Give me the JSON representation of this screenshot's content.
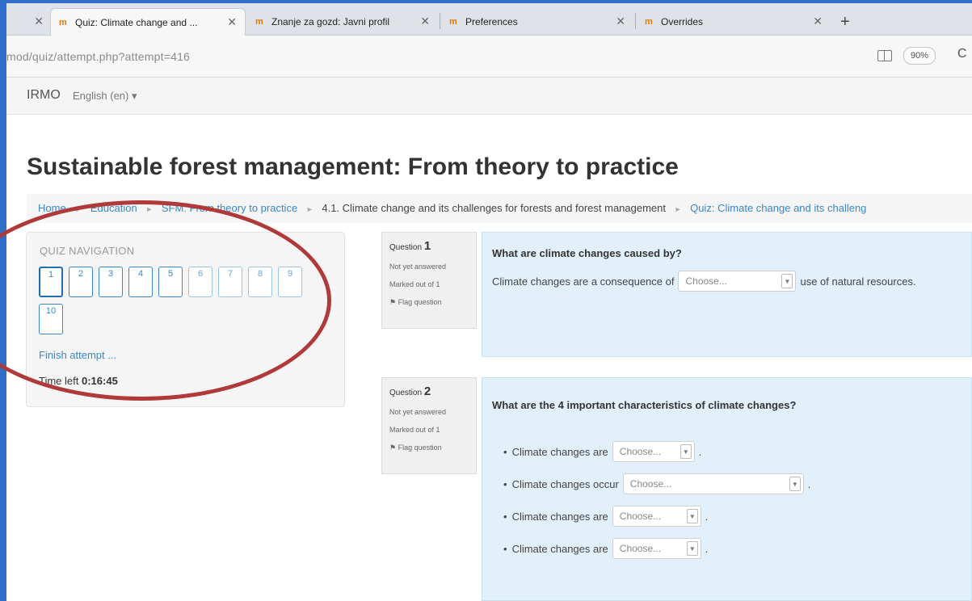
{
  "browser": {
    "tabs": [
      {
        "label": "",
        "active": false
      },
      {
        "label": "Quiz: Climate change and ...",
        "active": true
      },
      {
        "label": "Znanje za gozd: Javni profil",
        "active": false
      },
      {
        "label": "Preferences",
        "active": false
      },
      {
        "label": "Overrides",
        "active": false
      }
    ],
    "favicon_glyph": "m",
    "close_glyph": "✕",
    "new_tab_glyph": "+",
    "url": "mod/quiz/attempt.php?attempt=416",
    "zoom": "90%",
    "reload_glyph": "C"
  },
  "navbar": {
    "brand": "IRMO",
    "language": "English (en) ▾"
  },
  "page": {
    "title": "Sustainable forest management: From theory to practice"
  },
  "breadcrumb": [
    {
      "label": "Home",
      "link": true
    },
    {
      "label": "Education",
      "link": true
    },
    {
      "label": "SFM: From theory to practice",
      "link": true
    },
    {
      "label": "4.1. Climate change and its challenges for forests and forest management",
      "link": false
    },
    {
      "label": "Quiz: Climate change and its challeng",
      "link": true
    }
  ],
  "breadcrumb_separator": "►",
  "quiz_navigation": {
    "title": "QUIZ NAVIGATION",
    "buttons": [
      "1",
      "2",
      "3",
      "4",
      "5",
      "6",
      "7",
      "8",
      "9",
      "10"
    ],
    "finish_label": "Finish attempt ...",
    "time_label": "Time left",
    "time_value": "0:16:45"
  },
  "questions": [
    {
      "question_label": "Question",
      "number": "1",
      "state": "Not yet answered",
      "marks": "Marked out of 1",
      "flag_label": "Flag question",
      "text": "What are climate changes caused by?",
      "answer": {
        "prefix": "Climate changes are a consequence of",
        "select": "Choose...",
        "suffix": "use of natural resources."
      }
    },
    {
      "question_label": "Question",
      "number": "2",
      "state": "Not yet answered",
      "marks": "Marked out of 1",
      "flag_label": "Flag question",
      "text": "What are the 4 important characteristics of climate changes?",
      "items": [
        {
          "prefix": "Climate changes are",
          "select": "Choose...",
          "suffix": "."
        },
        {
          "prefix": "Climate changes occur",
          "select": "Choose...",
          "suffix": "."
        },
        {
          "prefix": "Climate changes are",
          "select": "Choose...",
          "suffix": "."
        },
        {
          "prefix": "Climate changes are",
          "select": "Choose...",
          "suffix": "."
        }
      ]
    }
  ],
  "glyphs": {
    "bullet": "•",
    "caret": "▼",
    "flag": "⚑"
  },
  "colors": {
    "link": "#3a86c8",
    "question_bg": "#e1f0fa",
    "annotation": "#b03a3a",
    "window_frame": "#2f6fc9"
  }
}
